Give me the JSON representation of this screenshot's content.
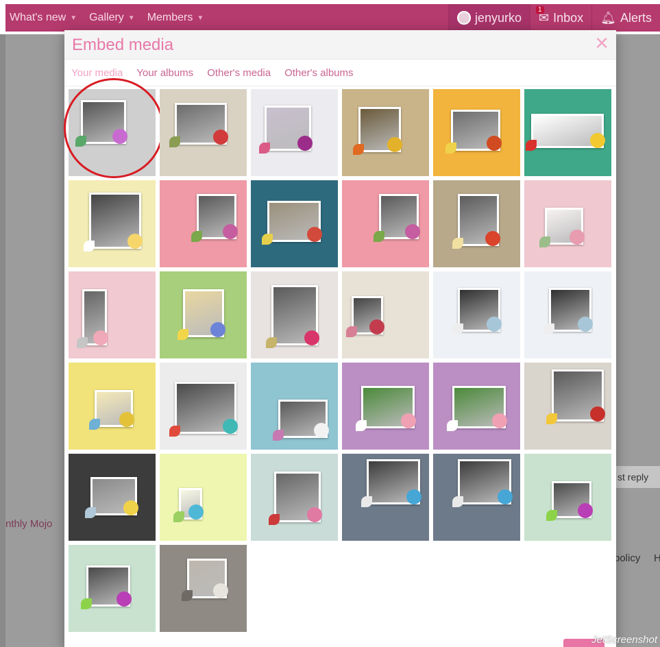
{
  "nav": {
    "left": [
      "What's new",
      "Gallery",
      "Members"
    ],
    "user": "jenyurko",
    "inbox": "Inbox",
    "inbox_count": "1",
    "alerts": "Alerts"
  },
  "background": {
    "fragment_mojo": "nthly Mojo",
    "fragment_policy": "policy",
    "fragment_h": "H",
    "fragment_reply": "st reply"
  },
  "modal": {
    "title": "Embed media",
    "close_icon": "close-icon",
    "tabs": [
      "Your media",
      "Your albums",
      "Other's media",
      "Other's albums"
    ],
    "active_tab": "Your media"
  },
  "watermark": "JetScreenshot",
  "colors": {
    "nav": "#b53a6e",
    "accent": "#e879a9",
    "highlight": "#d81c24"
  },
  "thumbs": [
    {
      "bg": "#cfcfcf",
      "photo": "#555",
      "f1": "#c86bd1",
      "f2": "#5aa76a"
    },
    {
      "bg": "#d9d2c3",
      "photo": "#6c6c6c",
      "f1": "#d23b3b",
      "f2": "#8a9d52"
    },
    {
      "bg": "#ecebef",
      "photo": "#c9c0cf",
      "f1": "#9b2c8a",
      "f2": "#d95b86"
    },
    {
      "bg": "#c9b48a",
      "photo": "#6a5a3a",
      "f1": "#e3b22a",
      "f2": "#e06a22"
    },
    {
      "bg": "#f2b43c",
      "photo": "#6e6e6e",
      "f1": "#d14b22",
      "f2": "#f0d24a"
    },
    {
      "bg": "#3fa889",
      "photo": "#ffffff",
      "f1": "#f2c930",
      "f2": "#d9322d"
    },
    {
      "bg": "#f3ecb5",
      "photo": "#444",
      "f1": "#f6d56b",
      "f2": "#ffffff"
    },
    {
      "bg": "#ef9aa6",
      "photo": "#5a5a5a",
      "f1": "#c55da0",
      "f2": "#7aa84a"
    },
    {
      "bg": "#2e6a7e",
      "photo": "#9a8f7a",
      "f1": "#d24a3c",
      "f2": "#e6d04b"
    },
    {
      "bg": "#ef9aa6",
      "photo": "#5a5a5a",
      "f1": "#c55da0",
      "f2": "#7aa84a"
    },
    {
      "bg": "#b8a98b",
      "photo": "#5c5c5c",
      "f1": "#d9442b",
      "f2": "#f1e0a0"
    },
    {
      "bg": "#f0c8cf",
      "photo": "#f7f2f2",
      "f1": "#e79cb0",
      "f2": "#9bbd8a"
    },
    {
      "bg": "#f1c9d0",
      "photo": "#666",
      "f1": "#f0a9b8",
      "f2": "#c5c5c5"
    },
    {
      "bg": "#a8cf7b",
      "photo": "#e9d7a0",
      "f1": "#6c83d7",
      "f2": "#f1d64a"
    },
    {
      "bg": "#e8e2e0",
      "photo": "#5a5a5a",
      "f1": "#d8366a",
      "f2": "#c6b46b"
    },
    {
      "bg": "#e8e1d5",
      "photo": "#444",
      "f1": "#c23c4e",
      "f2": "#d77f95"
    },
    {
      "bg": "#eef2f6",
      "photo": "#303030",
      "f1": "#a7c7d8",
      "f2": "#eeeeee"
    },
    {
      "bg": "#eef2f6",
      "photo": "#303030",
      "f1": "#a7c7d8",
      "f2": "#eeeeee"
    },
    {
      "bg": "#f1e27a",
      "photo": "#f5e9b8",
      "f1": "#e3c23a",
      "f2": "#6fb0d4"
    },
    {
      "bg": "#ececec",
      "photo": "#4a4a4a",
      "f1": "#3fb8b6",
      "f2": "#e04a3b"
    },
    {
      "bg": "#8fc4d1",
      "photo": "#5a5a5a",
      "f1": "#f2f2f2",
      "f2": "#c77ab2"
    },
    {
      "bg": "#bb8fc4",
      "photo": "#4b8a3a",
      "f1": "#f0a0b3",
      "f2": "#ffffff"
    },
    {
      "bg": "#bb8fc4",
      "photo": "#4b8a3a",
      "f1": "#f0a0b3",
      "f2": "#ffffff"
    },
    {
      "bg": "#d9d4cc",
      "photo": "#5a5a5a",
      "f1": "#c7302a",
      "f2": "#f2c73a"
    },
    {
      "bg": "#3c3c3c",
      "photo": "#8a8a8a",
      "f1": "#f0d14a",
      "f2": "#b0c8d8"
    },
    {
      "bg": "#eef6b0",
      "photo": "#f8f8e6",
      "f1": "#4fb8d6",
      "f2": "#9bd063"
    },
    {
      "bg": "#c9dcd7",
      "photo": "#666",
      "f1": "#e07aa3",
      "f2": "#cc3a3a"
    },
    {
      "bg": "#6d7a8a",
      "photo": "#3c3c3c",
      "f1": "#46a6d6",
      "f2": "#e9e9e9"
    },
    {
      "bg": "#6d7a8a",
      "photo": "#3c3c3c",
      "f1": "#46a6d6",
      "f2": "#e9e9e9"
    },
    {
      "bg": "#c9e2cf",
      "photo": "#4a4a4a",
      "f1": "#b93fb6",
      "f2": "#8dd34a"
    },
    {
      "bg": "#c9e2cf",
      "photo": "#4a4a4a",
      "f1": "#b93fb6",
      "f2": "#8dd34a"
    },
    {
      "bg": "#8f8a83",
      "photo": "#bdb7ad",
      "f1": "#e7e4dd",
      "f2": "#6f6a64"
    }
  ]
}
